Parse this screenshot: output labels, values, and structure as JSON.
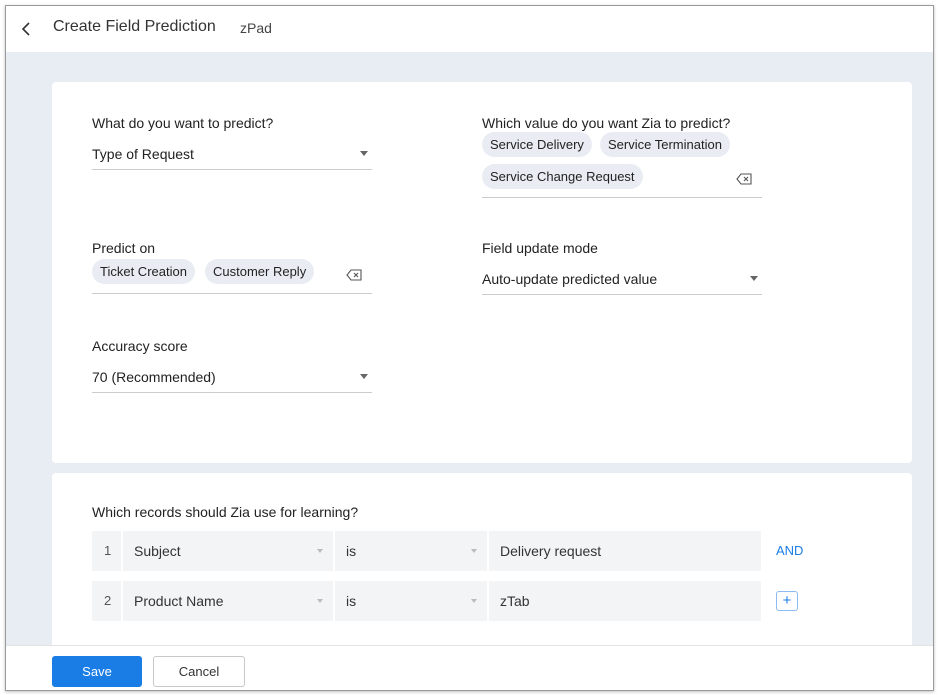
{
  "header": {
    "title": "Create Field Prediction",
    "app_name": "zPad"
  },
  "form": {
    "predict_field": {
      "label": "What do you want to predict?",
      "value": "Type of Request"
    },
    "predict_values": {
      "label": "Which value do you want Zia to predict?",
      "chips": [
        "Service Delivery",
        "Service Termination",
        "Service Change Request"
      ]
    },
    "predict_on": {
      "label": "Predict on",
      "chips": [
        "Ticket Creation",
        "Customer Reply"
      ]
    },
    "update_mode": {
      "label": "Field update mode",
      "value": "Auto-update predicted value"
    },
    "accuracy": {
      "label": "Accuracy score",
      "value": "70 (Recommended)"
    }
  },
  "criteria": {
    "title": "Which records should Zia use for learning?",
    "rows": [
      {
        "num": "1",
        "field": "Subject",
        "operator": "is",
        "value": "Delivery request",
        "action": "AND"
      },
      {
        "num": "2",
        "field": "Product Name",
        "operator": "is",
        "value": "zTab",
        "action": "+"
      }
    ]
  },
  "footer": {
    "save_label": "Save",
    "cancel_label": "Cancel"
  },
  "colors": {
    "accent": "#1a7de6",
    "page_background": "#e8ecf3",
    "chip_background": "#e9edf3"
  }
}
